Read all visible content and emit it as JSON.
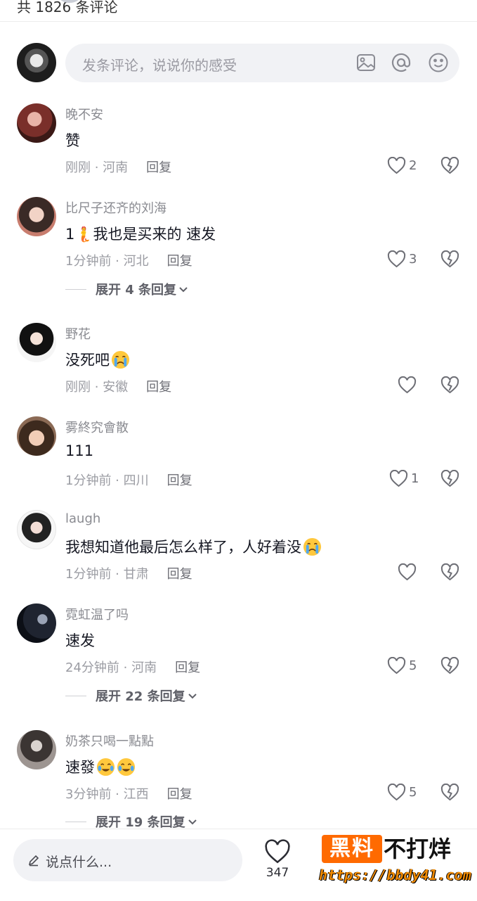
{
  "header": {
    "count_text": "共 1826 条评论"
  },
  "compose": {
    "placeholder": "发条评论，说说你的感受"
  },
  "comments": [
    {
      "user": "晚不安",
      "text": "赞",
      "time_loc": "刚刚 · 河南",
      "reply": "回复",
      "likes": "2",
      "emojis": []
    },
    {
      "user": "比尺子还齐的刘海",
      "text": "1🧜我也是买来的 速发",
      "time_loc": "1分钟前 · 河北",
      "reply": "回复",
      "likes": "3",
      "expand": "展开 4 条回复",
      "emojis": []
    },
    {
      "user": "野花",
      "text": "没死吧",
      "time_loc": "刚刚 · 安徽",
      "reply": "回复",
      "likes": "",
      "emojis": [
        "crying"
      ]
    },
    {
      "user": "雾終究會散",
      "text": "111",
      "time_loc": "1分钟前 · 四川",
      "reply": "回复",
      "likes": "1",
      "emojis": []
    },
    {
      "user": "laugh",
      "text": "我想知道他最后怎么样了，人好着没",
      "time_loc": "1分钟前 · 甘肃",
      "reply": "回复",
      "likes": "",
      "emojis": [
        "crying"
      ]
    },
    {
      "user": "霓虹温了吗",
      "text": "速发",
      "time_loc": "24分钟前 · 河南",
      "reply": "回复",
      "likes": "5",
      "expand": "展开 22 条回复",
      "emojis": []
    },
    {
      "user": "奶茶只喝一點點",
      "text": "速發",
      "time_loc": "3分钟前 · 江西",
      "reply": "回复",
      "likes": "5",
      "expand": "展开 19 条回复",
      "emojis": [
        "tearful-smile",
        "tearful-smile"
      ]
    }
  ],
  "bottom": {
    "placeholder": "说点什么...",
    "like_count": "347"
  },
  "watermark": {
    "brand": "黑料",
    "slogan": "不打烊",
    "url": "https://bbdy41.com"
  },
  "colors": {
    "text_primary": "#161823",
    "text_secondary": "#9b9ca3",
    "input_bg": "#f1f2f5",
    "watermark_orange": "#ff6a00"
  }
}
